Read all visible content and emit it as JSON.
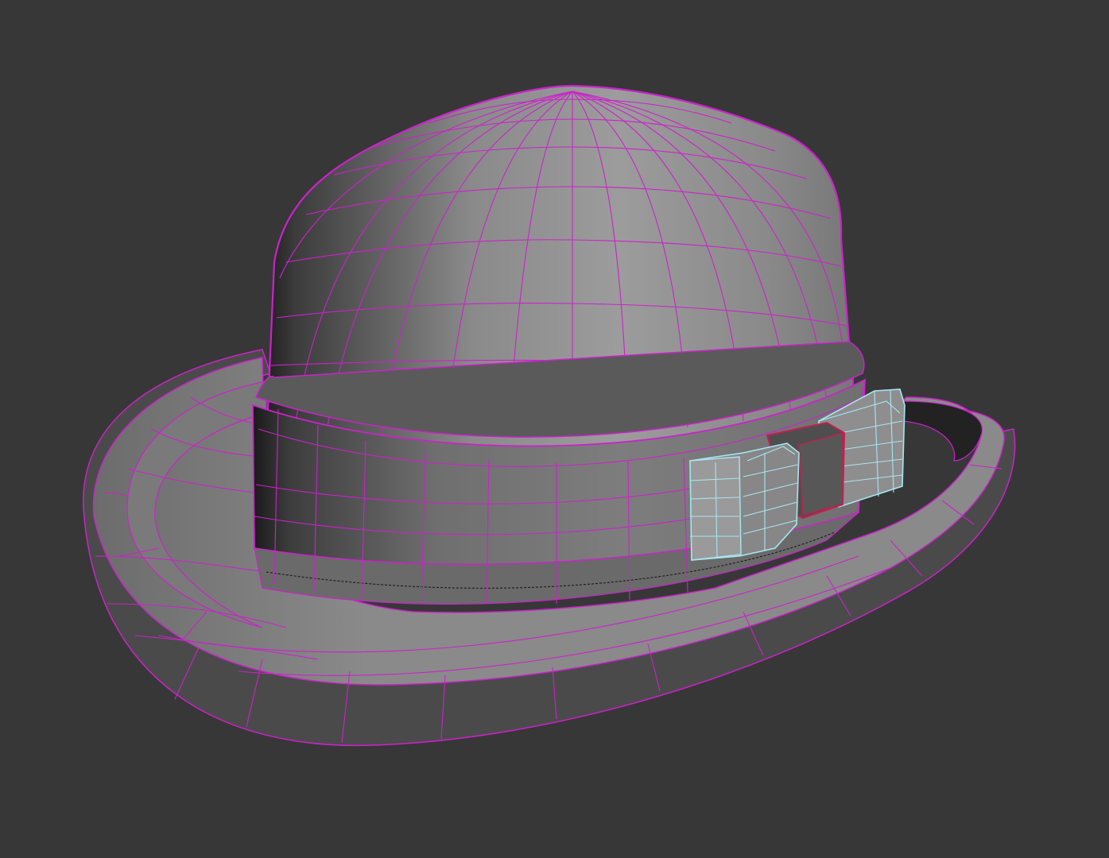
{
  "viewport": {
    "background": "#373737",
    "shading": "flat-gray-with-wireframe",
    "selection": "partial"
  },
  "model": {
    "object": "bowler-hat",
    "parts": [
      "crown",
      "hat-band",
      "brim",
      "bow"
    ]
  },
  "colors": {
    "wire_main": "#cc22cc",
    "wire_bow": "#a8e6f2",
    "wire_knot": "#c02050",
    "mesh_light": "#9a9a9a",
    "mesh_dark": "#1e1e1e"
  }
}
